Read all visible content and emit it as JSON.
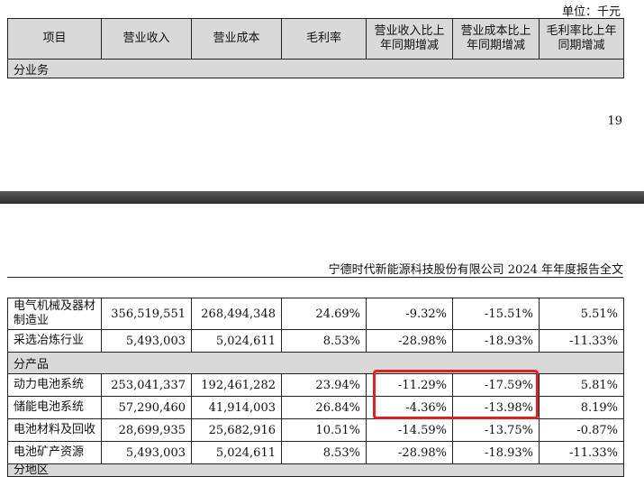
{
  "unit_label": "单位：千元",
  "columns": [
    "项目",
    "营业收入",
    "营业成本",
    "毛利率",
    "营业收入比上年同期增减",
    "营业成本比上年同期增减",
    "毛利率比上年同期增减"
  ],
  "columns_wrapped": [
    [
      "项目"
    ],
    [
      "营业收入"
    ],
    [
      "营业成本"
    ],
    [
      "毛利率"
    ],
    [
      "营业收入比上",
      "年同期增减"
    ],
    [
      "营业成本比上",
      "年同期增减"
    ],
    [
      "毛利率比上年",
      "同期增减"
    ]
  ],
  "section_by_business": "分业务",
  "page_number": "19",
  "running_header": "宁德时代新能源科技股份有限公司 2024 年年度报告全文",
  "rows_business": [
    {
      "label": [
        "电气机械及器材",
        "制造业"
      ],
      "revenue": "356,519,551",
      "cost": "268,494,348",
      "margin": "24.69%",
      "rev_change": "-9.32%",
      "cost_change": "-15.51%",
      "margin_change": "5.51%"
    },
    {
      "label": [
        "采选冶炼行业"
      ],
      "revenue": "5,493,003",
      "cost": "5,024,611",
      "margin": "8.53%",
      "rev_change": "-28.98%",
      "cost_change": "-18.93%",
      "margin_change": "-11.33%"
    }
  ],
  "section_by_product": "分产品",
  "rows_product": [
    {
      "label": [
        "动力电池系统"
      ],
      "revenue": "253,041,337",
      "cost": "192,461,282",
      "margin": "23.94%",
      "rev_change": "-11.29%",
      "cost_change": "-17.59%",
      "margin_change": "5.81%"
    },
    {
      "label": [
        "储能电池系统"
      ],
      "revenue": "57,290,460",
      "cost": "41,914,003",
      "margin": "26.84%",
      "rev_change": "-4.36%",
      "cost_change": "-13.98%",
      "margin_change": "8.19%"
    },
    {
      "label": [
        "电池材料及回收"
      ],
      "revenue": "28,699,935",
      "cost": "25,682,916",
      "margin": "10.51%",
      "rev_change": "-14.59%",
      "cost_change": "-13.75%",
      "margin_change": "-0.87%"
    },
    {
      "label": [
        "电池矿产资源"
      ],
      "revenue": "5,493,003",
      "cost": "5,024,611",
      "margin": "8.53%",
      "rev_change": "-28.98%",
      "cost_change": "-18.93%",
      "margin_change": "-11.33%"
    }
  ],
  "section_by_region_partial": "分地区",
  "highlight_color": "#e02020"
}
